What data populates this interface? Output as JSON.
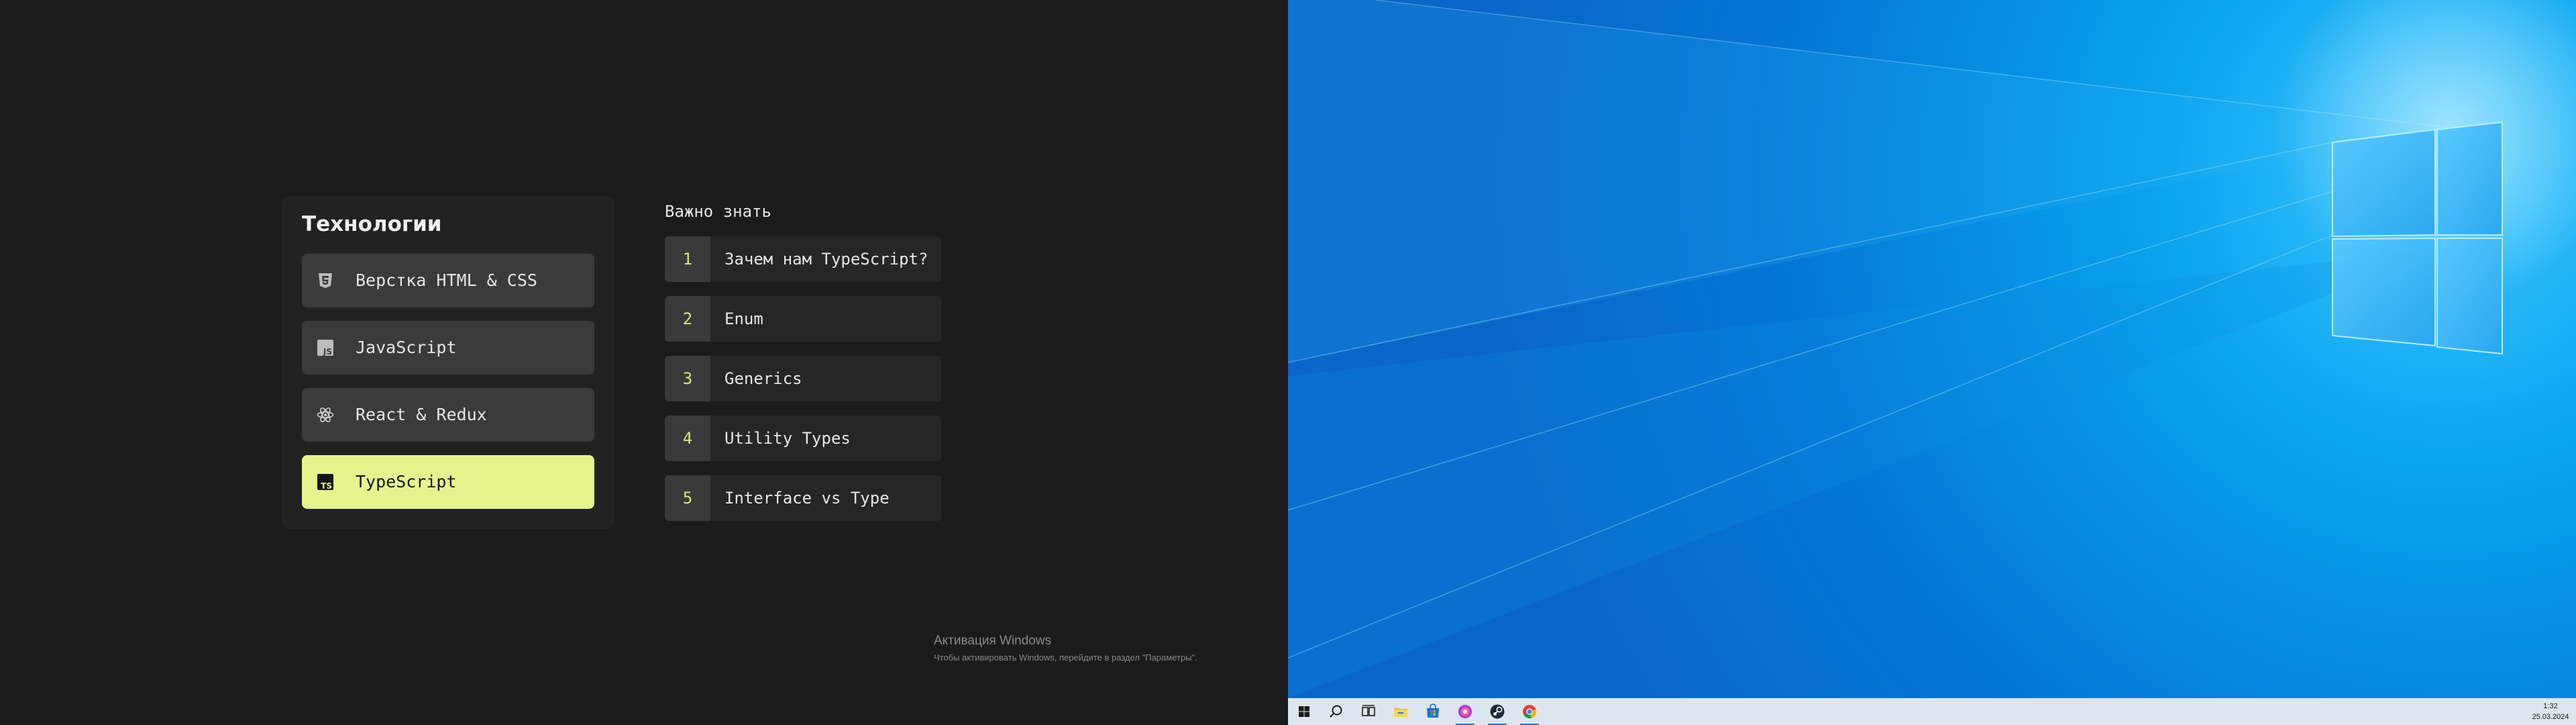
{
  "tech_panel": {
    "title": "Технологии",
    "items": [
      {
        "label": "Верстка HTML & CSS",
        "icon": "html5-icon",
        "active": false
      },
      {
        "label": "JavaScript",
        "icon": "javascript-icon",
        "active": false
      },
      {
        "label": "React & Redux",
        "icon": "react-icon",
        "active": false
      },
      {
        "label": "TypeScript",
        "icon": "typescript-icon",
        "active": true
      }
    ]
  },
  "must_know": {
    "title": "Важно знать",
    "items": [
      {
        "num": "1",
        "label": "Зачем нам TypeScript?"
      },
      {
        "num": "2",
        "label": "Enum"
      },
      {
        "num": "3",
        "label": "Generics"
      },
      {
        "num": "4",
        "label": "Utility Types"
      },
      {
        "num": "5",
        "label": "Interface vs Type"
      }
    ]
  },
  "activation": {
    "title": "Активация Windows",
    "subtitle": "Чтобы активировать Windows, перейдите в раздел \"Параметры\"."
  },
  "taskbar": {
    "items": [
      {
        "icon": "start-icon"
      },
      {
        "icon": "search-icon"
      },
      {
        "icon": "task-view-icon"
      },
      {
        "icon": "file-explorer-icon"
      },
      {
        "icon": "store-icon"
      },
      {
        "icon": "messenger-icon",
        "running": true
      },
      {
        "icon": "steam-icon",
        "running": true
      },
      {
        "icon": "chrome-icon",
        "running": true
      }
    ],
    "clock": {
      "time": "1:32",
      "date": "25.03.2024"
    }
  },
  "colors": {
    "accent": "#e5f48f",
    "number_accent": "#d9e77a",
    "panel_bg": "#222222",
    "item_bg": "#3b3b3b",
    "desktop_blue": "#0a78d7"
  }
}
